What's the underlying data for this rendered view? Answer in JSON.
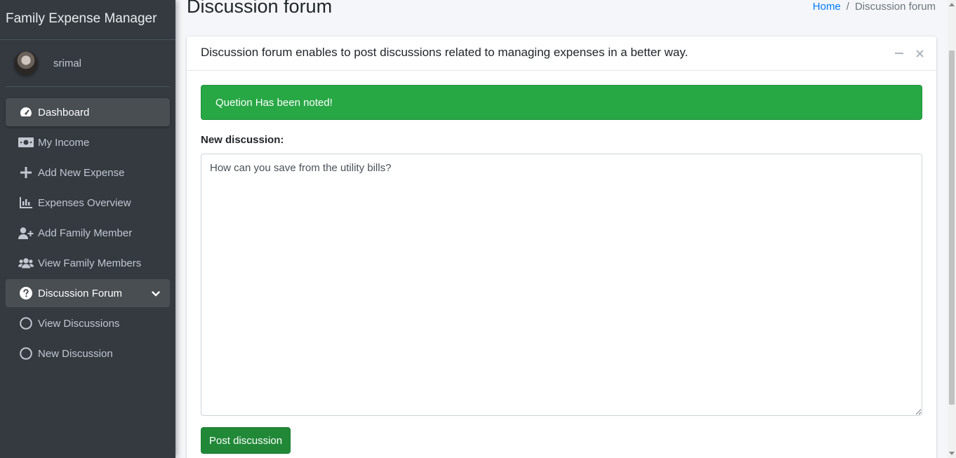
{
  "app": {
    "title": "Family Expense Manager"
  },
  "user": {
    "name": "srimal"
  },
  "sidebar": {
    "items": [
      {
        "label": "Dashboard",
        "icon": "tachometer-icon"
      },
      {
        "label": "My Income",
        "icon": "money-bill-icon"
      },
      {
        "label": "Add New Expense",
        "icon": "plus-icon"
      },
      {
        "label": "Expenses Overview",
        "icon": "chart-bar-icon"
      },
      {
        "label": "Add Family Member",
        "icon": "user-plus-icon"
      },
      {
        "label": "View Family Members",
        "icon": "users-icon"
      },
      {
        "label": "Discussion Forum",
        "icon": "question-circle-icon"
      },
      {
        "label": "View Discussions",
        "icon": "circle-icon"
      },
      {
        "label": "New Discussion",
        "icon": "circle-icon"
      }
    ]
  },
  "page": {
    "title": "Discussion forum",
    "breadcrumb": {
      "home": "Home",
      "separator": "/",
      "current": "Discussion forum"
    }
  },
  "card": {
    "header": "Discussion forum enables to post discussions related to managing expenses in a better way.",
    "alert": "Quetion Has been noted!",
    "field_label": "New discussion:",
    "textarea_value": "How can you save from the utility bills?",
    "submit_label": "Post discussion"
  },
  "colors": {
    "sidebar_bg": "#343a40",
    "success": "#28a745",
    "link": "#007bff"
  }
}
